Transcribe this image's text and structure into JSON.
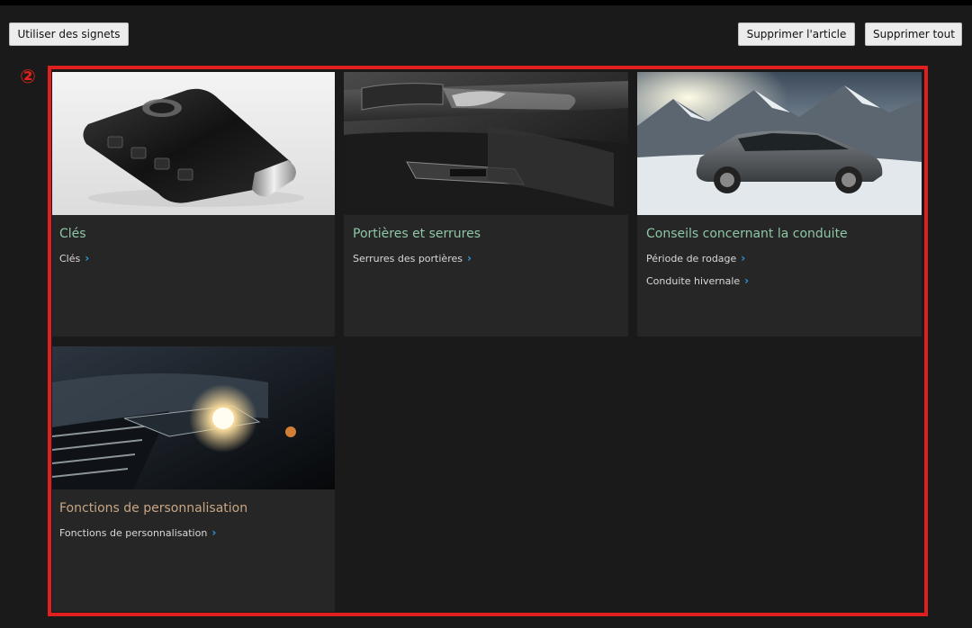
{
  "toolbar": {
    "bookmarks_label": "Utiliser des signets",
    "delete_article_label": "Supprimer l'article",
    "delete_all_label": "Supprimer tout"
  },
  "marker": "②",
  "cards": [
    {
      "title": "Clés",
      "links": [
        "Clés"
      ],
      "image": "smart-key-photo"
    },
    {
      "title": "Portières et serrures",
      "links": [
        "Serrures des portières"
      ],
      "image": "door-interior-photo"
    },
    {
      "title": "Conseils concernant la conduite",
      "links": [
        "Période de rodage",
        "Conduite hivernale"
      ],
      "image": "suv-snow-photo"
    },
    {
      "title": "Fonctions de personnalisation",
      "links": [
        "Fonctions de personnalisation"
      ],
      "image": "headlight-photo"
    }
  ],
  "colors": {
    "title_green": "#8ec7a6",
    "title_amber": "#c9a684",
    "chevron_blue": "#2a9ad8",
    "frame_red": "#e01f1f"
  }
}
